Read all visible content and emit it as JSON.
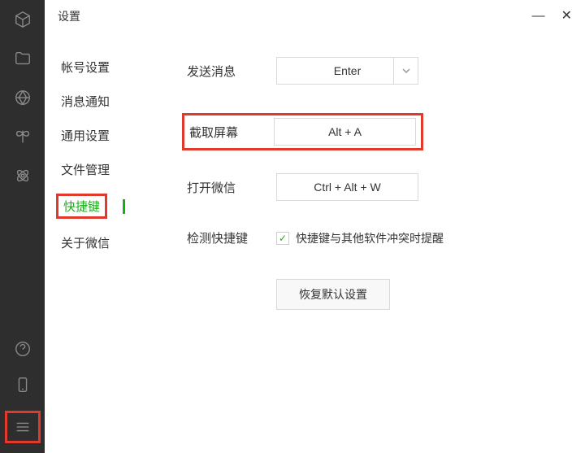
{
  "window": {
    "title": "设置"
  },
  "nav": {
    "items": [
      {
        "label": "帐号设置"
      },
      {
        "label": "消息通知"
      },
      {
        "label": "通用设置"
      },
      {
        "label": "文件管理"
      },
      {
        "label": "快捷键"
      },
      {
        "label": "关于微信"
      }
    ]
  },
  "settings": {
    "send_message": {
      "label": "发送消息",
      "value": "Enter"
    },
    "screenshot": {
      "label": "截取屏幕",
      "value": "Alt + A"
    },
    "open_wechat": {
      "label": "打开微信",
      "value": "Ctrl + Alt + W"
    },
    "detect_shortcut": {
      "label": "检测快捷键",
      "checkbox_label": "快捷键与其他软件冲突时提醒"
    },
    "reset_button": "恢复默认设置"
  }
}
